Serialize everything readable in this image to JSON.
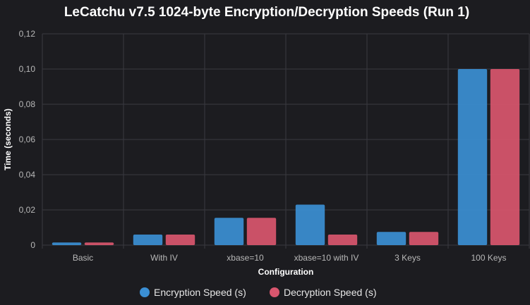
{
  "chart_data": {
    "type": "bar",
    "title": "LeCatchu v7.5 1024-byte Encryption/Decryption Speeds (Run 1)",
    "xlabel": "Configuration",
    "ylabel": "Time (seconds)",
    "categories": [
      "Basic",
      "With IV",
      "xbase=10",
      "xbase=10 with IV",
      "3 Keys",
      "100 Keys"
    ],
    "series": [
      {
        "name": "Encryption Speed (s)",
        "color": "#3b8fd4",
        "values": [
          0.0015,
          0.006,
          0.0155,
          0.023,
          0.0075,
          0.1
        ]
      },
      {
        "name": "Decryption Speed (s)",
        "color": "#d9566e",
        "values": [
          0.0015,
          0.006,
          0.0155,
          0.006,
          0.0075,
          0.1
        ]
      }
    ],
    "ylim": [
      0,
      0.12
    ],
    "yticks": [
      "0",
      "0,02",
      "0,04",
      "0,06",
      "0,08",
      "0,10",
      "0,12"
    ],
    "grid": true,
    "legend_position": "bottom"
  }
}
